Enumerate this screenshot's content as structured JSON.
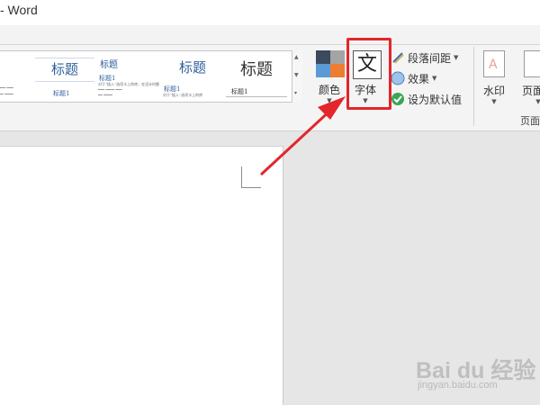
{
  "window": {
    "title": "- Word"
  },
  "style_gallery": {
    "items": [
      {
        "big": "",
        "small": "",
        "body": ""
      },
      {
        "big": "标题",
        "small": "标题1",
        "body": ""
      },
      {
        "big": "标题",
        "small": "标题1",
        "body": "对于“插入”选项卡上的库，在设计时都应考虑其中的项与文档整体外观的协调性"
      },
      {
        "big": "标题",
        "small": "标题1",
        "body": "对于“插入”选项卡上的库"
      },
      {
        "big": "标题",
        "small": "标题1",
        "body": ""
      }
    ]
  },
  "ribbon": {
    "colors_label": "颜色",
    "fonts_glyph": "文",
    "fonts_label": "字体",
    "paragraph_spacing_label": "段落间距",
    "effects_label": "效果",
    "set_default_label": "设为默认值",
    "watermark_label": "水印",
    "page_color_label": "页面颜",
    "group_label": "页面"
  },
  "colors": {
    "theme_swatch": [
      "#3b4a5c",
      "#a4a4a4",
      "#5b9bd5",
      "#ed7d31"
    ],
    "highlight": "#e2262b",
    "accent": "#2e5f9a"
  },
  "watermark_site": {
    "logo": "Bai du 经验",
    "url": "jingyan.baidu.com"
  }
}
